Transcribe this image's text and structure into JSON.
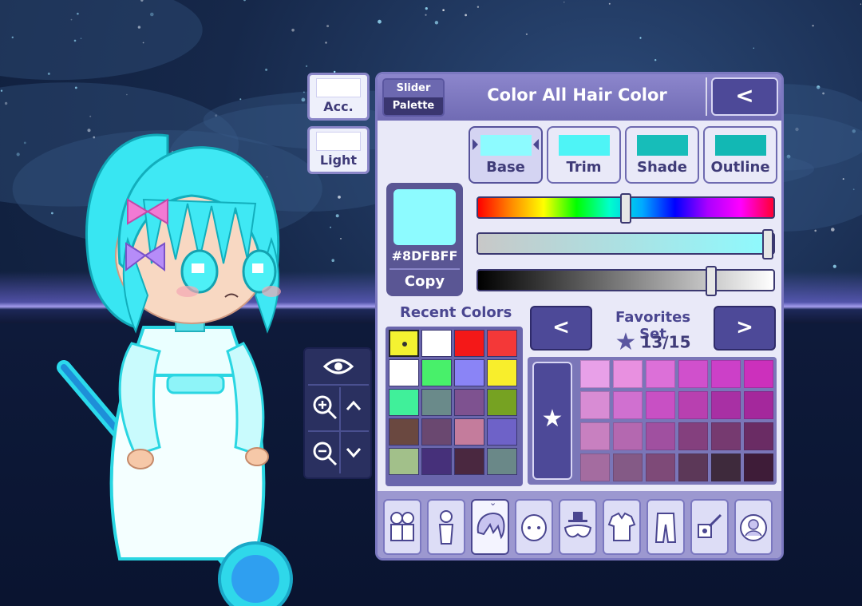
{
  "panel": {
    "title": "Color All Hair Color",
    "mode_toggle": {
      "slider_label": "Slider",
      "palette_label": "Palette",
      "active": "Palette"
    },
    "back_label": "<"
  },
  "side_buttons": {
    "acc_label": "Acc.",
    "light_label": "Light"
  },
  "part_tabs": [
    {
      "label": "Base",
      "color": "#8DFBFF",
      "selected": true
    },
    {
      "label": "Trim",
      "color": "#4EF4F6",
      "selected": false
    },
    {
      "label": "Shade",
      "color": "#17BDB9",
      "selected": false
    },
    {
      "label": "Outline",
      "color": "#12B8B4",
      "selected": false
    }
  ],
  "current_color": {
    "hex": "#8DFBFF",
    "copy_label": "Copy"
  },
  "sliders": {
    "hue": 0.5,
    "saturation": 1.0,
    "value": 0.8
  },
  "recent": {
    "title": "Recent Colors",
    "colors": [
      "#F4F231",
      "#FFFFFF",
      "#F41818",
      "#F43838",
      "#FFFFFF",
      "#48F06A",
      "#8A84F6",
      "#F8EE2C",
      "#40F09A",
      "#6A8A8A",
      "#7E5290",
      "#76A222",
      "#6A4840",
      "#6A4870",
      "#C47C9C",
      "#6E62C8",
      "#A2C08A",
      "#46307A",
      "#4A2840",
      "#6A8888"
    ],
    "selected_index": 0
  },
  "favorites": {
    "title": "Favorites Set",
    "count": "13/15",
    "prev_label": "<",
    "next_label": ">",
    "star_label": "★",
    "colors": [
      "#E8A0E8",
      "#E890E0",
      "#DC70D8",
      "#D050CC",
      "#CC40C8",
      "#CC30BC",
      "#D88CD4",
      "#D070D0",
      "#C850C4",
      "#B840B0",
      "#A830A4",
      "#A4289C",
      "#C880C0",
      "#B468B0",
      "#A050A0",
      "#84407E",
      "#763A70",
      "#6A2C64",
      "#A46CA0",
      "#845A86",
      "#7E4A78",
      "#5C3858",
      "#3E2A3C",
      "#3E1C38"
    ]
  },
  "view_controls": {
    "eye_icon": "eye-icon",
    "zoom_in_icon": "zoom-in-icon",
    "zoom_out_icon": "zoom-out-icon",
    "up_icon": "chevron-up-icon",
    "down_icon": "chevron-down-icon"
  },
  "categories": [
    "presets",
    "body",
    "hair",
    "face",
    "accessories",
    "tops",
    "bottoms",
    "props",
    "profile"
  ],
  "active_category": "hair"
}
